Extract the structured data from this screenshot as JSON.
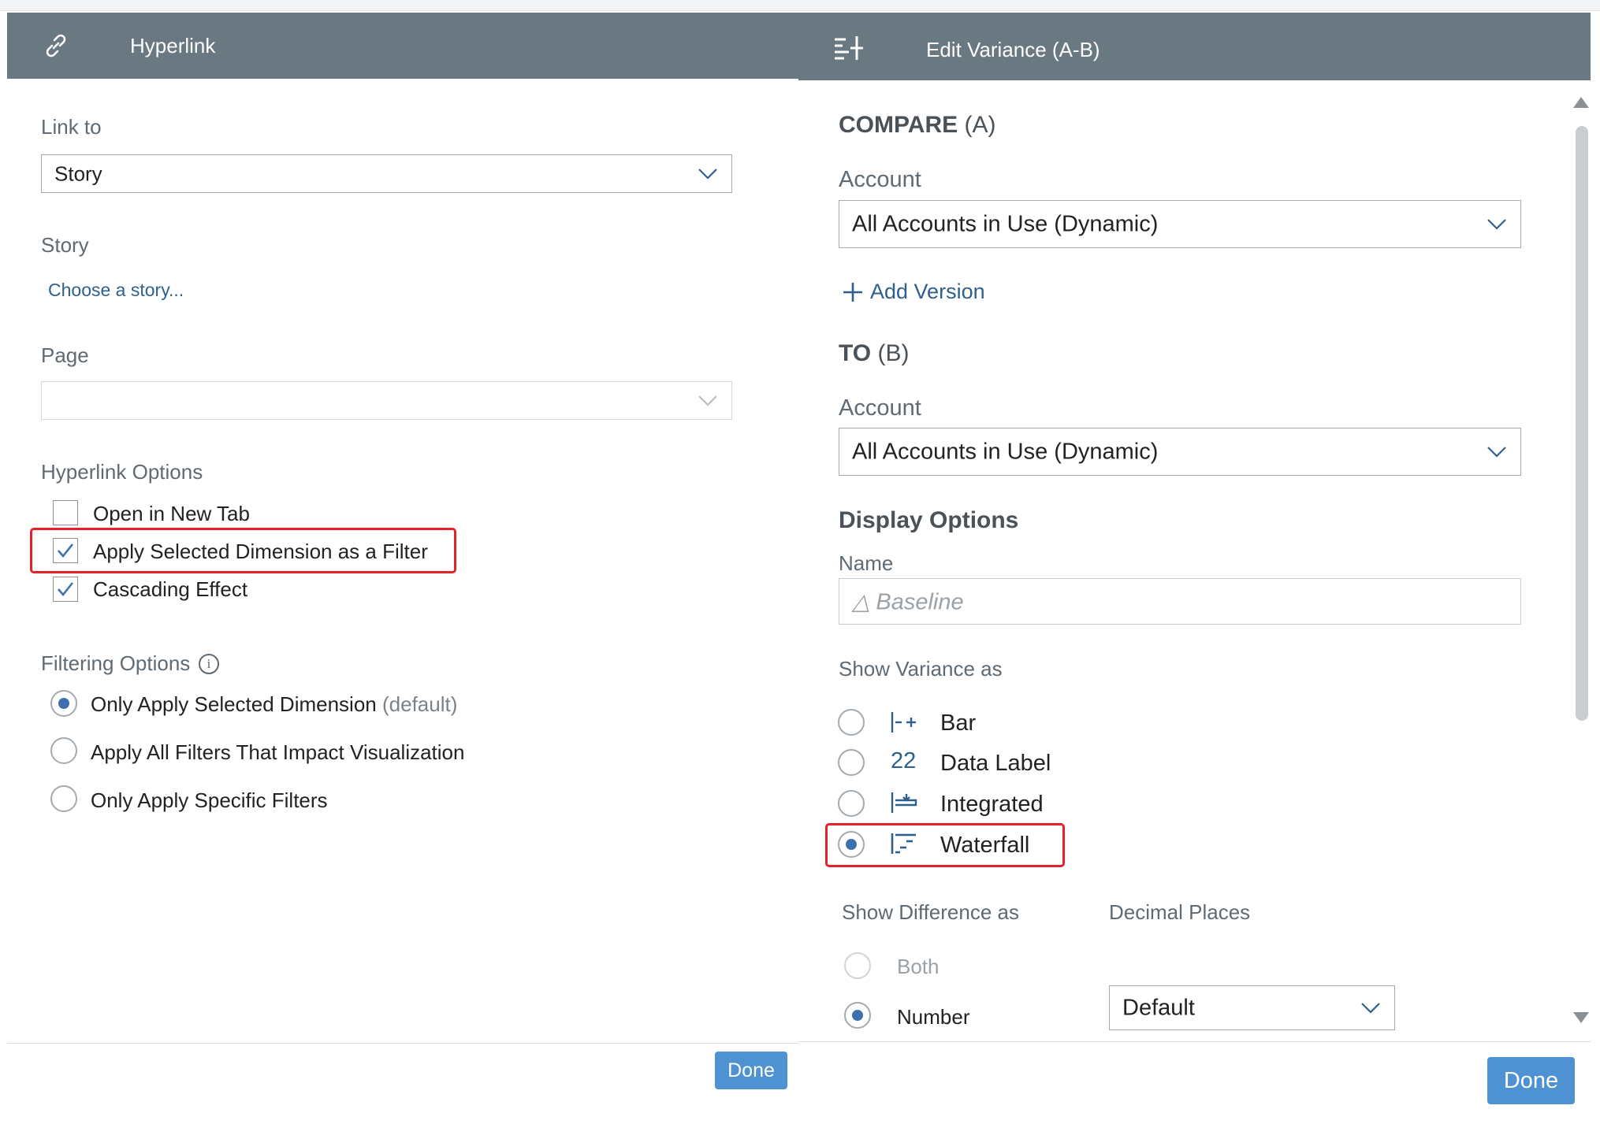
{
  "hyperlink": {
    "title": "Hyperlink",
    "link_to_label": "Link to",
    "link_to_value": "Story",
    "story_label": "Story",
    "choose_story": "Choose a story...",
    "page_label": "Page",
    "page_value": "",
    "options_label": "Hyperlink Options",
    "options": [
      {
        "label": "Open in New Tab",
        "checked": false
      },
      {
        "label": "Apply Selected Dimension as a Filter",
        "checked": true
      },
      {
        "label": "Cascading Effect",
        "checked": true
      }
    ],
    "filtering_label": "Filtering Options",
    "filtering": [
      {
        "label": "Only Apply Selected Dimension",
        "suffix": "(default)",
        "selected": true
      },
      {
        "label": "Apply All Filters That Impact Visualization",
        "suffix": "",
        "selected": false
      },
      {
        "label": "Only Apply Specific Filters",
        "suffix": "",
        "selected": false
      }
    ],
    "done_label": "Done"
  },
  "variance": {
    "title": "Edit Variance (A-B)",
    "compare_bold": "COMPARE",
    "compare_suffix": "(A)",
    "account_label_a": "Account",
    "account_value_a": "All Accounts in Use (Dynamic)",
    "add_version": "Add Version",
    "to_bold": "TO",
    "to_suffix": "(B)",
    "account_label_b": "Account",
    "account_value_b": "All Accounts in Use (Dynamic)",
    "display_options": "Display Options",
    "name_label": "Name",
    "name_placeholder": "△ Baseline",
    "show_variance_label": "Show Variance as",
    "variance_options": [
      {
        "label": "Bar",
        "icon": "bar-variance-icon",
        "selected": false
      },
      {
        "label": "Data Label",
        "icon": "data-label-icon",
        "icon_text": "22",
        "selected": false
      },
      {
        "label": "Integrated",
        "icon": "integrated-icon",
        "selected": false
      },
      {
        "label": "Waterfall",
        "icon": "waterfall-icon",
        "selected": true
      }
    ],
    "show_difference_label": "Show Difference as",
    "decimal_places_label": "Decimal Places",
    "difference_options": [
      {
        "label": "Both",
        "selected": false
      },
      {
        "label": "Number",
        "selected": true
      }
    ],
    "decimal_value": "Default",
    "done_label": "Done"
  },
  "colors": {
    "header": "#6a7881",
    "accent": "#3e6fb0",
    "button": "#4f92d2",
    "highlight": "#e5222a"
  }
}
